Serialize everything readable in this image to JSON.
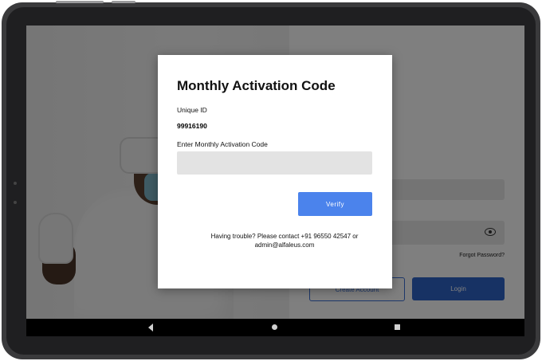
{
  "dialog": {
    "title": "Monthly Activation Code",
    "unique_id_label": "Unique ID",
    "unique_id_value": "99916190",
    "code_label": "Enter Monthly Activation Code",
    "code_value": "",
    "verify_label": "Verify",
    "help_line1": "Having trouble? Please contact +91 96550 42547 or",
    "help_line2": "admin@alfaleus.com"
  },
  "background": {
    "forgot_password": "Forgot Password?",
    "create_account": "Create Account",
    "login": "Login"
  },
  "icons": {
    "password_toggle": "eye-icon",
    "nav_back": "back-triangle-icon",
    "nav_home": "home-circle-icon",
    "nav_recent": "recent-square-icon"
  },
  "colors": {
    "verify_button": "#4b83ec",
    "login_button": "#2f65c9",
    "overlay": "rgba(0,0,0,0.5)",
    "input_bg": "#e3e3e3"
  }
}
